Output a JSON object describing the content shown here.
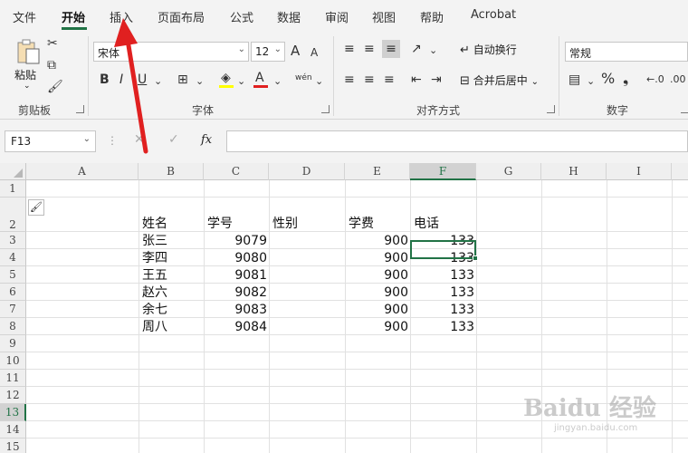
{
  "tabs": [
    "文件",
    "开始",
    "插入",
    "页面布局",
    "公式",
    "数据",
    "审阅",
    "视图",
    "帮助",
    "Acrobat"
  ],
  "clipboard": {
    "paste": "粘贴",
    "label": "剪贴板"
  },
  "font": {
    "name": "宋体",
    "size": "12",
    "bold": "B",
    "italic": "I",
    "underline": "U",
    "font_color_letter": "A",
    "grow": "A",
    "shrink": "A",
    "phonetic": "wén",
    "label": "字体"
  },
  "align": {
    "wrap": "自动换行",
    "merge": "合并后居中",
    "label": "对齐方式"
  },
  "number": {
    "format": "常规",
    "percent": "%",
    "comma": "❟",
    "label": "数字"
  },
  "formula_bar": {
    "namebox": "F13",
    "fx": "fx",
    "value": ""
  },
  "columns": [
    "A",
    "B",
    "C",
    "D",
    "E",
    "F",
    "G",
    "H",
    "I"
  ],
  "selected_col": "F",
  "rows": [
    "1",
    "2",
    "3",
    "4",
    "5",
    "6",
    "7",
    "8",
    "9",
    "10",
    "11",
    "12",
    "13",
    "14",
    "15"
  ],
  "selected_row": "13",
  "sheet": {
    "headers": {
      "name": "姓名",
      "id": "学号",
      "gender": "性别",
      "fee": "学费",
      "phone": "电话"
    },
    "records": [
      {
        "name": "张三",
        "id": "9079",
        "fee": "900",
        "phone": "133"
      },
      {
        "name": "李四",
        "id": "9080",
        "fee": "900",
        "phone": "133"
      },
      {
        "name": "王五",
        "id": "9081",
        "fee": "900",
        "phone": "133"
      },
      {
        "name": "赵六",
        "id": "9082",
        "fee": "900",
        "phone": "133"
      },
      {
        "name": "余七",
        "id": "9083",
        "fee": "900",
        "phone": "133"
      },
      {
        "name": "周八",
        "id": "9084",
        "fee": "900",
        "phone": "133"
      }
    ]
  },
  "watermark": {
    "text": "Baidu 经验",
    "sub": "jingyan.baidu.com"
  },
  "colors": {
    "accent": "#217346",
    "arrow": "#e02020",
    "font_color_bar": "#e02020",
    "fill_bar": "#ffff00"
  }
}
